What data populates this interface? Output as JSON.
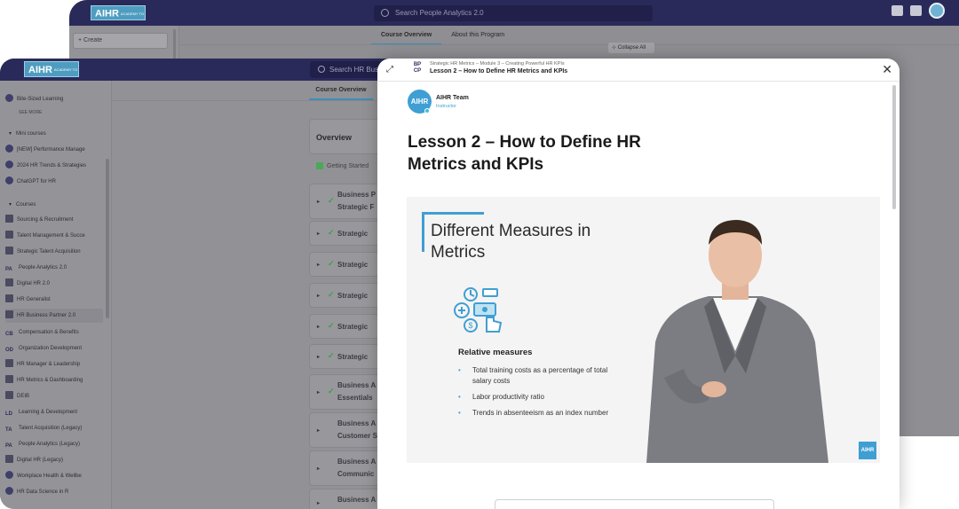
{
  "back_window": {
    "logo": "AIHR",
    "logo_sub": "ACADEMY TO INNOVATE HR",
    "search_placeholder": "Search People Analytics 2.0",
    "create_label": "+ Create",
    "tabs": [
      "Course Overview",
      "About this Program"
    ],
    "active_tab": 0,
    "collapse_label": "Collapse All"
  },
  "front_window": {
    "logo": "AIHR",
    "logo_sub": "ACADEMY TO INNOVATE HR",
    "search_placeholder": "Search HR Bus",
    "tab": "Course Overview",
    "sidebar": {
      "items_top": [
        {
          "label": "Bite-Sized Learning",
          "icon": "bite-sized-icon"
        }
      ],
      "see_more": "SEE MORE",
      "mini_courses_header": "Mini courses",
      "mini_courses": [
        {
          "label": "[NEW] Performance Manage",
          "icon": "lightning-icon"
        },
        {
          "label": "2024 HR Trends & Strategies",
          "icon": "trend-icon"
        },
        {
          "label": "ChatGPT for HR",
          "icon": "chatgpt-icon"
        }
      ],
      "courses_header": "Courses",
      "courses": [
        {
          "label": "Sourcing & Recruitment",
          "icon": "sourcing-icon",
          "abbr": ""
        },
        {
          "label": "Talent Management & Succe",
          "icon": "talent-icon",
          "abbr": ""
        },
        {
          "label": "Strategic Talent Acquisition",
          "icon": "acquisition-icon",
          "abbr": ""
        },
        {
          "label": "People Analytics 2.0",
          "icon": "pa-icon",
          "abbr": "PA"
        },
        {
          "label": "Digital HR 2.0",
          "icon": "digital-hr-icon",
          "abbr": ""
        },
        {
          "label": "HR Generalist",
          "icon": "generalist-icon",
          "abbr": ""
        },
        {
          "label": "HR Business Partner 2.0",
          "icon": "hrbp-icon",
          "abbr": "",
          "active": true
        },
        {
          "label": "Compensation & Benefits",
          "icon": "cb-icon",
          "abbr": "CB"
        },
        {
          "label": "Organization Development",
          "icon": "od-icon",
          "abbr": "OD"
        },
        {
          "label": "HR Manager & Leadership",
          "icon": "manager-icon",
          "abbr": ""
        },
        {
          "label": "HR Metrics & Dashboarding",
          "icon": "metrics-icon",
          "abbr": ""
        },
        {
          "label": "DEIB",
          "icon": "deib-icon",
          "abbr": ""
        },
        {
          "label": "Learning & Development",
          "icon": "ld-icon",
          "abbr": "LD"
        },
        {
          "label": "Talent Acquisition (Legacy)",
          "icon": "ta-icon",
          "abbr": "TA"
        },
        {
          "label": "People Analytics (Legacy)",
          "icon": "pa-legacy-icon",
          "abbr": "PA"
        },
        {
          "label": "Digital HR (Legacy)",
          "icon": "digital-legacy-icon",
          "abbr": ""
        },
        {
          "label": "Workplace Health & Wellbe",
          "icon": "wellbeing-icon",
          "abbr": ""
        },
        {
          "label": "HR Data Science in R",
          "icon": "datasci-icon",
          "abbr": ""
        }
      ]
    },
    "overview_label": "Overview",
    "getting_started": "Getting Started",
    "modules": [
      {
        "lines": [
          "Business P",
          "Strategic F"
        ],
        "checked": true
      },
      {
        "lines": [
          "Strategic"
        ],
        "checked": true
      },
      {
        "lines": [
          "Strategic"
        ],
        "checked": true
      },
      {
        "lines": [
          "Strategic"
        ],
        "checked": true
      },
      {
        "lines": [
          "Strategic"
        ],
        "checked": true
      },
      {
        "lines": [
          "Strategic"
        ],
        "checked": true
      },
      {
        "lines": [
          "Business A",
          "Essentials"
        ],
        "checked": true
      },
      {
        "lines": [
          "Business A",
          "Customer S"
        ],
        "checked": false
      },
      {
        "lines": [
          "Business A",
          "Communic"
        ],
        "checked": false
      },
      {
        "lines": [
          "Business A"
        ],
        "checked": false
      }
    ]
  },
  "modal": {
    "course_code": "BP CP",
    "breadcrumb": "Strategic HR Metrics – Module 3 – Creating Powerful HR KPIs",
    "lesson_crumb": "Lesson 2 – How to Define HR Metrics and KPIs",
    "instructor_name": "AIHR Team",
    "instructor_role": "Instructor",
    "avatar_text": "AIHR",
    "lesson_title": "Lesson 2 – How to Define HR Metrics and KPIs",
    "video": {
      "slide_title": "Different Measures in Metrics",
      "section_heading": "Relative measures",
      "bullets": [
        "Total training costs as a percentage of total salary costs",
        "Labor productivity ratio",
        "Trends in absenteeism as an index number"
      ],
      "badge": "AIHR"
    }
  },
  "colors": {
    "brand_blue": "#3f9fd3",
    "topbar": "#2a2a5a",
    "check_green": "#3b9e4a"
  }
}
